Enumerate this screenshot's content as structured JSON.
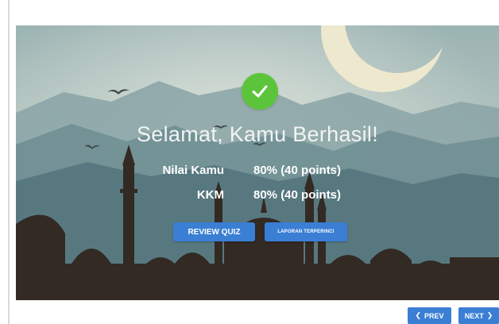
{
  "result": {
    "title": "Selamat, Kamu Berhasil!",
    "score_label": "Nilai Kamu",
    "score_value": "80% (40 points)",
    "kkm_label": "KKM",
    "kkm_value": "80% (40 points)"
  },
  "buttons": {
    "review_label": "REVIEW QUIZ",
    "report_label": "LAPORAN TERPERINCI"
  },
  "navigation": {
    "prev_label": "PREV",
    "next_label": "NEXT",
    "prev_icon": "chevron-left-icon",
    "next_icon": "chevron-right-icon"
  },
  "colors": {
    "success": "#5cc43a",
    "button": "#3a7fd4"
  }
}
